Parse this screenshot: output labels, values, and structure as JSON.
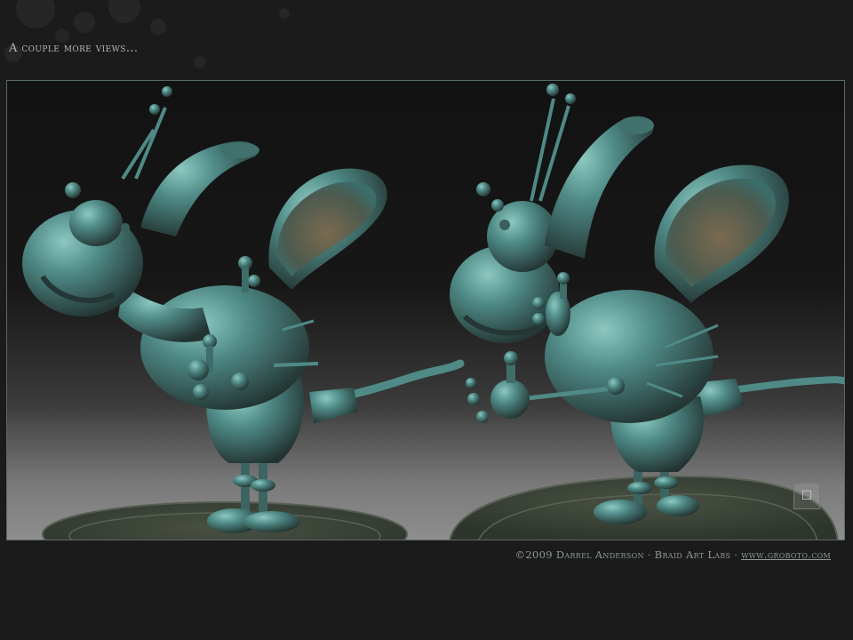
{
  "header": {
    "title": "A couple more views..."
  },
  "footer": {
    "credit": "©2009 Darrel Anderson · Braid Art Labs · ",
    "link_text": "www.groboto.com"
  },
  "badge": {
    "icon": "signature-logo-icon",
    "glyph": "☐"
  },
  "colors": {
    "background": "#1b1b1b",
    "figure_teal": "#4f8a86",
    "figure_shadow": "#2c3d3a",
    "figure_highlight": "#7fbdb5",
    "base_dark": "#3a4036"
  }
}
